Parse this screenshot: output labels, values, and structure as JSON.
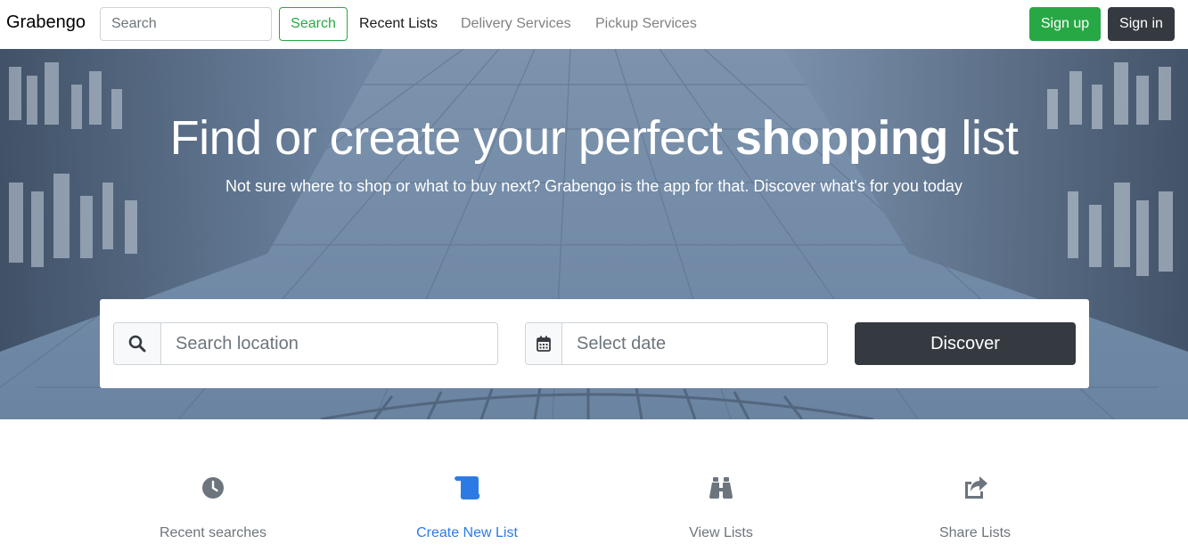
{
  "navbar": {
    "brand": "Grabengo",
    "search_placeholder": "Search",
    "search_button": "Search",
    "links": [
      {
        "label": "Recent Lists",
        "active": true
      },
      {
        "label": "Delivery Services",
        "active": false
      },
      {
        "label": "Pickup Services",
        "active": false
      }
    ],
    "signup_label": "Sign up",
    "signin_label": "Sign in"
  },
  "hero": {
    "title_pre": "Find or create your perfect ",
    "title_bold": "shopping",
    "title_post": " list",
    "subtitle": "Not sure where to shop or what to buy next? Grabengo is the app for that. Discover what's for you today",
    "location_placeholder": "Search location",
    "date_placeholder": "Select date",
    "discover_label": "Discover",
    "location_icon": "search-icon",
    "date_icon": "calendar-icon"
  },
  "features": [
    {
      "label": "Recent searches",
      "icon": "clock-icon"
    },
    {
      "label": "Create New List",
      "icon": "scroll-icon"
    },
    {
      "label": "View Lists",
      "icon": "binoculars-icon"
    },
    {
      "label": "Share Lists",
      "icon": "share-icon"
    }
  ],
  "colors": {
    "success": "#28a745",
    "dark": "#343a40",
    "primary": "#2c7be5",
    "muted": "#6c757d"
  }
}
